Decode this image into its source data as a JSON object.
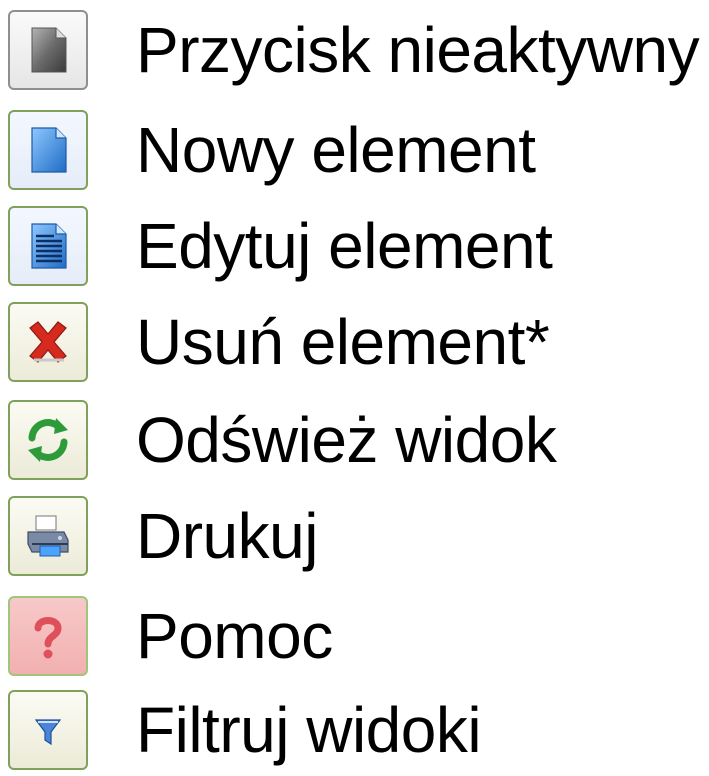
{
  "legend": {
    "items": [
      {
        "icon": "inactive-document-icon",
        "label": "Przycisk nieaktywny"
      },
      {
        "icon": "new-document-icon",
        "label": "Nowy element"
      },
      {
        "icon": "edit-document-icon",
        "label": "Edytuj element"
      },
      {
        "icon": "delete-x-icon",
        "label": "Usuń element*"
      },
      {
        "icon": "refresh-arrows-icon",
        "label": "Odśwież widok"
      },
      {
        "icon": "printer-icon",
        "label": "Drukuj"
      },
      {
        "icon": "help-question-icon",
        "label": "Pomoc"
      },
      {
        "icon": "filter-funnel-icon",
        "label": "Filtruj widoki"
      }
    ]
  },
  "colors": {
    "button_border": "#7fa15c",
    "inactive_border": "#8f8f8f",
    "document_blue": "#2f7fd6",
    "delete_red": "#d62a1e",
    "refresh_green": "#2e9b3a",
    "help_red": "#e0505a"
  }
}
